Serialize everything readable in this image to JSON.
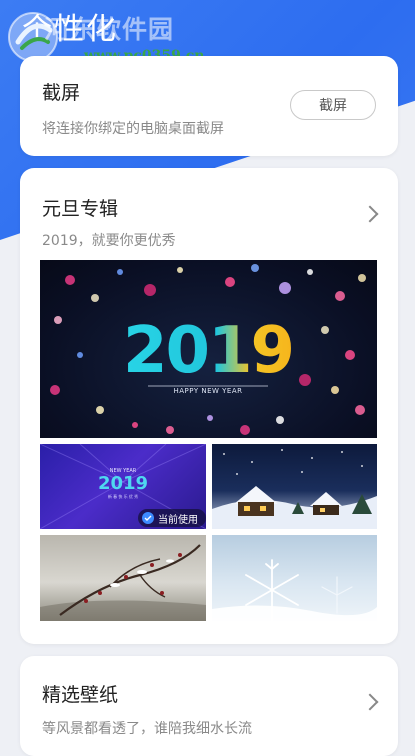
{
  "header": {
    "title": "个性化",
    "watermark": {
      "title": "河东软件园",
      "url": "www.pc0359.cn"
    }
  },
  "screenshot_card": {
    "title": "截屏",
    "subtitle": "将连接你绑定的电脑桌面截屏",
    "button_label": "截屏"
  },
  "album_card": {
    "title": "元旦专辑",
    "subtitle": "2019，就要你更优秀",
    "banner": {
      "year": "2019",
      "caption": "HAPPY NEW YEAR"
    },
    "thumbs": [
      {
        "name": "new-year-purple",
        "year": "2019",
        "heading": "NEW YEAR",
        "line": "新 春 快 乐 优 秀",
        "badge": "当前使用"
      },
      {
        "name": "snow-village"
      },
      {
        "name": "snowy-branch"
      },
      {
        "name": "snowflake"
      }
    ]
  },
  "wallpaper_card": {
    "title": "精选壁纸",
    "subtitle": "等风景都看透了，谁陪我细水长流"
  },
  "colors": {
    "accent": "#2d6df0",
    "card_bg": "#ffffff",
    "page_bg": "#eef0f5"
  }
}
